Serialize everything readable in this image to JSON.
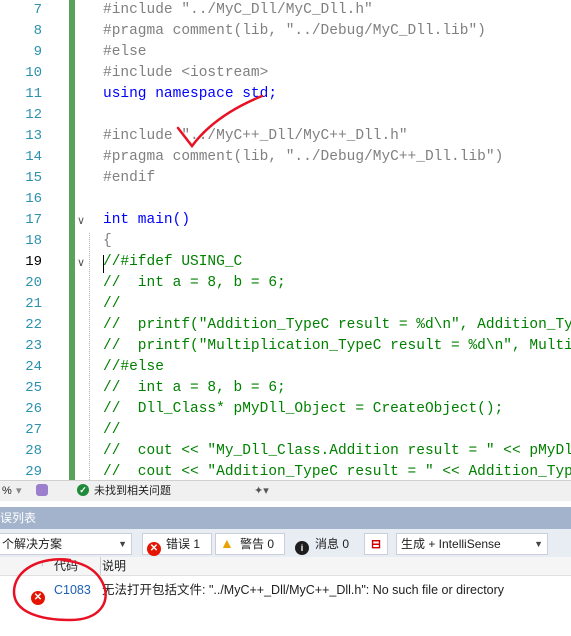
{
  "editor": {
    "current_line": "19",
    "lines": [
      {
        "n": "7",
        "text": "#include \"../MyC_Dll/MyC_Dll.h\""
      },
      {
        "n": "8",
        "text": "#pragma comment(lib, \"../Debug/MyC_Dll.lib\")"
      },
      {
        "n": "9",
        "text": "#else"
      },
      {
        "n": "10",
        "text": "#include <iostream>"
      },
      {
        "n": "11",
        "text": "using namespace std;"
      },
      {
        "n": "12",
        "text": ""
      },
      {
        "n": "13",
        "text": "#include \"../MyC++_Dll/MyC++_Dll.h\""
      },
      {
        "n": "14",
        "text": "#pragma comment(lib, \"../Debug/MyC++_Dll.lib\")"
      },
      {
        "n": "15",
        "text": "#endif"
      },
      {
        "n": "16",
        "text": ""
      },
      {
        "n": "17",
        "text": "int main()"
      },
      {
        "n": "18",
        "text": "{"
      },
      {
        "n": "19",
        "text": "//#ifdef USING_C"
      },
      {
        "n": "20",
        "text": "//  int a = 8, b = 6;"
      },
      {
        "n": "21",
        "text": "//"
      },
      {
        "n": "22",
        "text": "//  printf(\"Addition_TypeC result = %d\\n\", Addition_TypeC"
      },
      {
        "n": "23",
        "text": "//  printf(\"Multiplication_TypeC result = %d\\n\", Multipl"
      },
      {
        "n": "24",
        "text": "//#else"
      },
      {
        "n": "25",
        "text": "//  int a = 8, b = 6;"
      },
      {
        "n": "26",
        "text": "//  Dll_Class* pMyDll_Object = CreateObject();"
      },
      {
        "n": "27",
        "text": "//"
      },
      {
        "n": "28",
        "text": "//  cout << \"My_Dll_Class.Addition result = \" << pMyDll_"
      },
      {
        "n": "29",
        "text": "//  cout << \"Addition_TypeC result = \" << Addition_TypeC"
      }
    ]
  },
  "statusbar": {
    "zoom": "%",
    "issues_text": "未找到相关问题"
  },
  "error_list": {
    "title": "误列表",
    "scope_value": "个解决方案",
    "errors_label": "错误 1",
    "warnings_label": "警告 0",
    "messages_label": "消息 0",
    "build_filter_value": "生成 + IntelliSense",
    "col_code": "代码",
    "col_desc": "说明",
    "rows": [
      {
        "code": "C1083",
        "description": "无法打开包括文件: \"../MyC++_Dll/MyC++_Dll.h\": No such file or directory"
      }
    ]
  },
  "colors": {
    "change_bar": "#5aa25a",
    "error_red": "#e51400",
    "annotation_red": "#e81123",
    "line_number": "#2b91af"
  }
}
